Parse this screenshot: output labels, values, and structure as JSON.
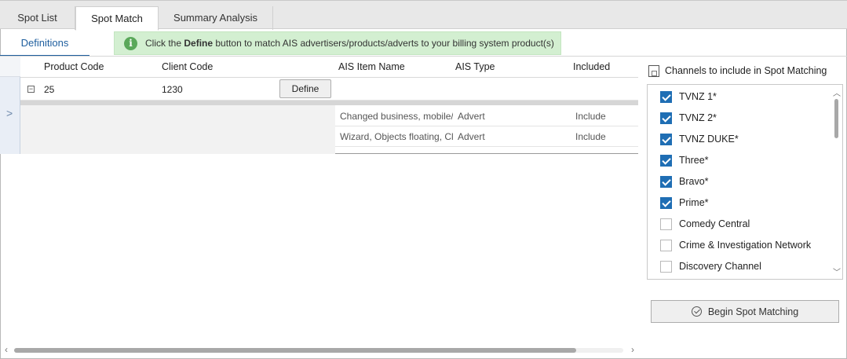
{
  "tabs": [
    {
      "label": "Spot List"
    },
    {
      "label": "Spot Match",
      "active": true
    },
    {
      "label": "Summary Analysis"
    }
  ],
  "subtab": {
    "label": "Definitions"
  },
  "info": {
    "icon": "info-icon",
    "prefix": "Click the ",
    "bold": "Define",
    "suffix": " button to match AIS advertisers/products/adverts to your billing system product(s)"
  },
  "grid": {
    "columns": {
      "product_code": "Product Code",
      "client_code": "Client Code",
      "ais_item_name": "AIS Item Name",
      "ais_type": "AIS Type",
      "included": "Included"
    },
    "row": {
      "expand_symbol": "⊟",
      "product_code": "25",
      "client_code": "1230",
      "define_label": "Define"
    },
    "selector_arrow": ">",
    "details": [
      {
        "name": "Changed business, mobile/",
        "type": "Advert",
        "included": "Include"
      },
      {
        "name": "Wizard, Objects floating, Cl",
        "type": "Advert",
        "included": "Include"
      }
    ]
  },
  "channels": {
    "title": "Channels to include in Spot Matching",
    "items": [
      {
        "label": "TVNZ 1*",
        "checked": true
      },
      {
        "label": "TVNZ 2*",
        "checked": true
      },
      {
        "label": "TVNZ DUKE*",
        "checked": true
      },
      {
        "label": "Three*",
        "checked": true
      },
      {
        "label": "Bravo*",
        "checked": true
      },
      {
        "label": "Prime*",
        "checked": true
      },
      {
        "label": "Comedy Central",
        "checked": false
      },
      {
        "label": "Crime & Investigation Network",
        "checked": false
      },
      {
        "label": "Discovery Channel",
        "checked": false
      }
    ]
  },
  "actions": {
    "begin_label": "Begin Spot Matching"
  },
  "colors": {
    "accent": "#1e5e9e",
    "checkbox_on": "#1f6eb4",
    "info_bg": "#d3efd1",
    "info_icon": "#5aa85a"
  }
}
